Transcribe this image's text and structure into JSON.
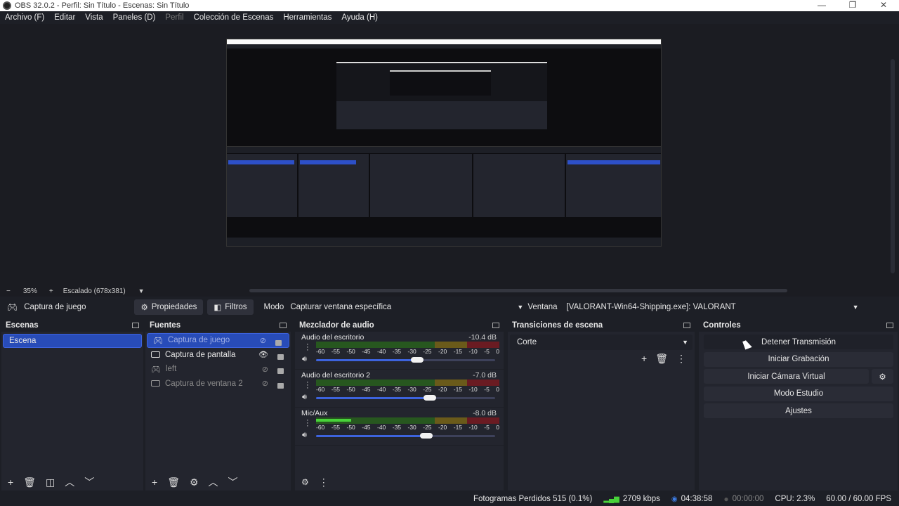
{
  "window": {
    "title": "OBS 32.0.2 - Perfil: Sin Título - Escenas: Sin Título"
  },
  "menu": [
    "Archivo (F)",
    "Editar",
    "Vista",
    "Paneles (D)",
    "Perfil",
    "Colección de Escenas",
    "Herramientas",
    "Ayuda (H)"
  ],
  "zoom": {
    "minus": "−",
    "level": "35%",
    "plus": "+",
    "scale": "Escalado (678x381)"
  },
  "source_bar": {
    "selected_source": "Captura de juego",
    "properties": "Propiedades",
    "filters": "Filtros",
    "mode_label": "Modo",
    "mode_value": "Capturar ventana específica",
    "window_label": "Ventana",
    "window_value": "[VALORANT-Win64-Shipping.exe]: VALORANT"
  },
  "scenes": {
    "title": "Escenas",
    "items": [
      "Escena"
    ]
  },
  "sources": {
    "title": "Fuentes",
    "items": [
      "Captura de juego",
      "Captura de pantalla",
      "left",
      "Captura de ventana 2"
    ]
  },
  "mixer": {
    "title": "Mezclador de audio",
    "channels": [
      {
        "name": "Audio del escritorio",
        "db": "-10.4 dB",
        "level": 0.62
      },
      {
        "name": "Audio del escritorio 2",
        "db": "-7.0 dB",
        "level": 0.7
      },
      {
        "name": "Mic/Aux",
        "db": "-8.0 dB",
        "level": 0.68
      }
    ],
    "ticks": [
      "-60",
      "-55",
      "-50",
      "-45",
      "-40",
      "-35",
      "-30",
      "-25",
      "-20",
      "-15",
      "-10",
      "-5",
      "0"
    ]
  },
  "transitions": {
    "title": "Transiciones de escena",
    "value": "Corte"
  },
  "controls": {
    "title": "Controles",
    "stop_stream": "Detener Transmisión",
    "start_record": "Iniciar Grabación",
    "start_vcam": "Iniciar Cámara Virtual",
    "studio_mode": "Modo Estudio",
    "settings": "Ajustes"
  },
  "status": {
    "dropped": "Fotogramas Perdidos 515 (0.1%)",
    "bitrate": "2709 kbps",
    "stream_time": "04:38:58",
    "rec_time": "00:00:00",
    "cpu": "CPU: 2.3%",
    "fps": "60.00 / 60.00 FPS"
  },
  "colors": {
    "accent": "#284cb8",
    "meter_green": "#48d23a"
  }
}
